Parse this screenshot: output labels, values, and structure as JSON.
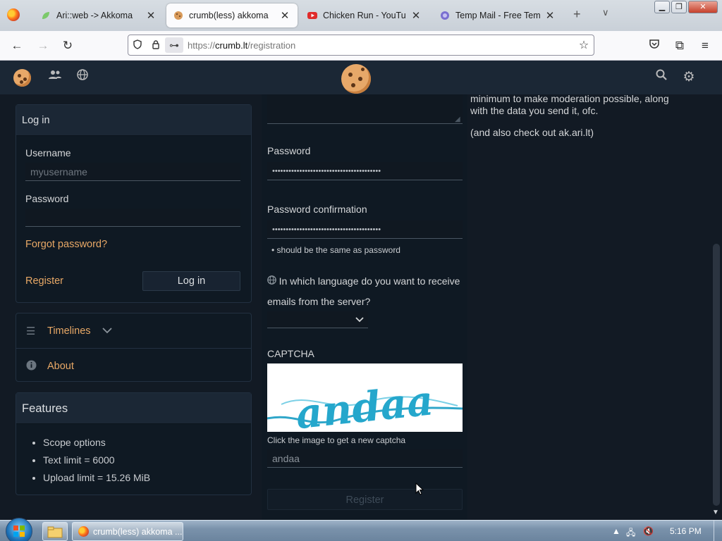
{
  "browser": {
    "tabs": [
      {
        "title": "Ari::web -> Akkoma",
        "active": false,
        "favicon": "leaf-icon"
      },
      {
        "title": "crumb(less) akkoma",
        "active": true,
        "favicon": "cookie-icon"
      },
      {
        "title": "Chicken Run - YouTube",
        "active": false,
        "favicon": "youtube-icon"
      },
      {
        "title": "Temp Mail - Free Tempo",
        "active": false,
        "favicon": "tempmail-icon"
      }
    ],
    "url_scheme": "https://",
    "url_host": "crumb.lt",
    "url_path": "/registration"
  },
  "login_panel": {
    "heading": "Log in",
    "username_label": "Username",
    "username_placeholder": "myusername",
    "password_label": "Password",
    "forgot_link": "Forgot password?",
    "register_link": "Register",
    "login_button": "Log in"
  },
  "nav_panel": {
    "timelines": "Timelines",
    "about": "About"
  },
  "features_panel": {
    "heading": "Features",
    "items": [
      "Scope options",
      "Text limit = 6000",
      "Upload limit = 15.26 MiB"
    ]
  },
  "registration": {
    "password_label": "Password",
    "password_mask": "••••••••••••••••••••••••••••••••••••••••",
    "confirm_label": "Password confirmation",
    "confirm_mask": "••••••••••••••••••••••••••••••••••••••••",
    "confirm_hint": "should be the same as password",
    "language_question_a": "In which language do you want to receive",
    "language_question_b": "emails from the server?",
    "captcha_label": "CAPTCHA",
    "captcha_word": "andaa",
    "captcha_hint": "Click the image to get a new captcha",
    "captcha_input_value": "andaa",
    "register_button": "Register"
  },
  "sidebar_text": {
    "line1": "minimum to make moderation possible, along",
    "line2": "with the data you send it, ofc.",
    "line3": "(and also check out ak.ari.lt)"
  },
  "taskbar": {
    "window_title": "crumb(less) akkoma ...",
    "clock": "5:16 PM"
  }
}
